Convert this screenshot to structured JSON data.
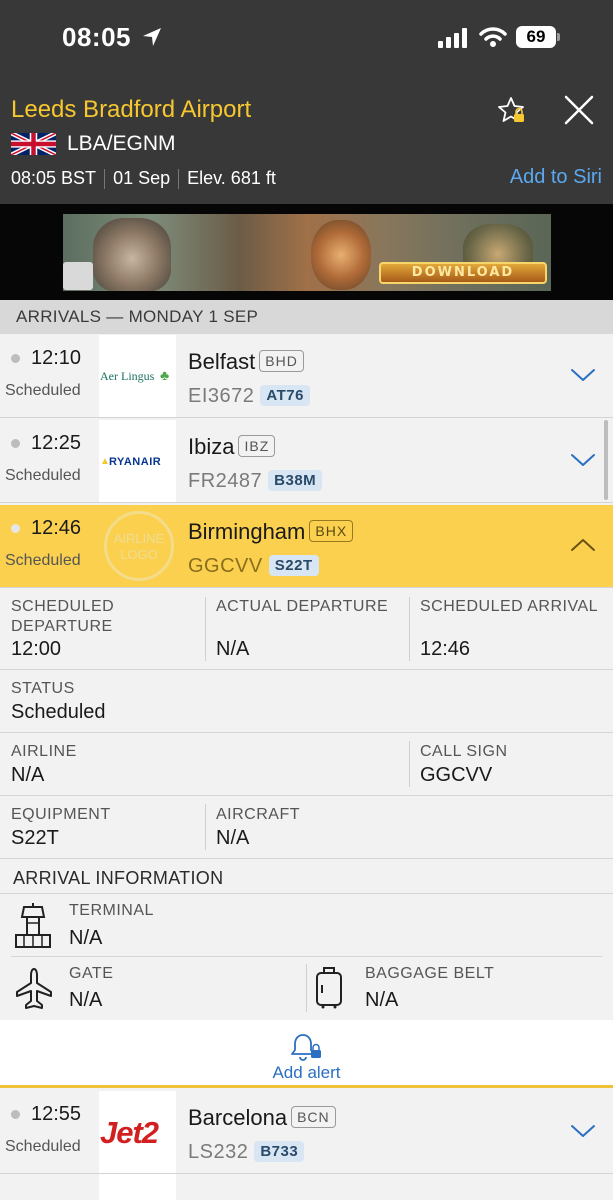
{
  "status_bar": {
    "time": "08:05",
    "battery": "69"
  },
  "header": {
    "airport_name": "Leeds Bradford Airport",
    "code": "LBA/EGNM",
    "local_time": "08:05 BST",
    "date": "01 Sep",
    "elevation": "Elev. 681 ft",
    "siri_label": "Add to Siri",
    "accent_color": "#f7c72f"
  },
  "ad": {
    "button_text": "DOWNLOAD"
  },
  "section": {
    "title": "ARRIVALS — MONDAY 1 SEP"
  },
  "flights": [
    {
      "time": "12:10",
      "status": "Scheduled",
      "airline_logo": "Aer Lingus",
      "city": "Belfast",
      "iata": "BHD",
      "flight_no": "EI3672",
      "aircraft": "AT76"
    },
    {
      "time": "12:25",
      "status": "Scheduled",
      "airline_logo": "RYANAIR",
      "city": "Ibiza",
      "iata": "IBZ",
      "flight_no": "FR2487",
      "aircraft": "B38M"
    },
    {
      "time": "12:46",
      "status": "Scheduled",
      "airline_logo": "AIRLINE LOGO",
      "city": "Birmingham",
      "iata": "BHX",
      "flight_no": "GGCVV",
      "aircraft": "S22T"
    },
    {
      "time": "12:55",
      "status": "Scheduled",
      "airline_logo": "Jet2",
      "city": "Barcelona",
      "iata": "BCN",
      "flight_no": "LS232",
      "aircraft": "B733"
    }
  ],
  "details": {
    "scheduled_departure": {
      "label": "SCHEDULED DEPARTURE",
      "value": "12:00"
    },
    "actual_departure": {
      "label": "ACTUAL DEPARTURE",
      "value": "N/A"
    },
    "scheduled_arrival": {
      "label": "SCHEDULED ARRIVAL",
      "value": "12:46"
    },
    "status": {
      "label": "STATUS",
      "value": "Scheduled"
    },
    "airline": {
      "label": "AIRLINE",
      "value": "N/A"
    },
    "call_sign": {
      "label": "CALL SIGN",
      "value": "GGCVV"
    },
    "equipment": {
      "label": "EQUIPMENT",
      "value": "S22T"
    },
    "aircraft": {
      "label": "AIRCRAFT",
      "value": "N/A"
    },
    "arrival_info_title": "ARRIVAL INFORMATION",
    "terminal": {
      "label": "TERMINAL",
      "value": "N/A"
    },
    "gate": {
      "label": "GATE",
      "value": "N/A"
    },
    "baggage_belt": {
      "label": "BAGGAGE BELT",
      "value": "N/A"
    }
  },
  "alert": {
    "label": "Add alert"
  }
}
